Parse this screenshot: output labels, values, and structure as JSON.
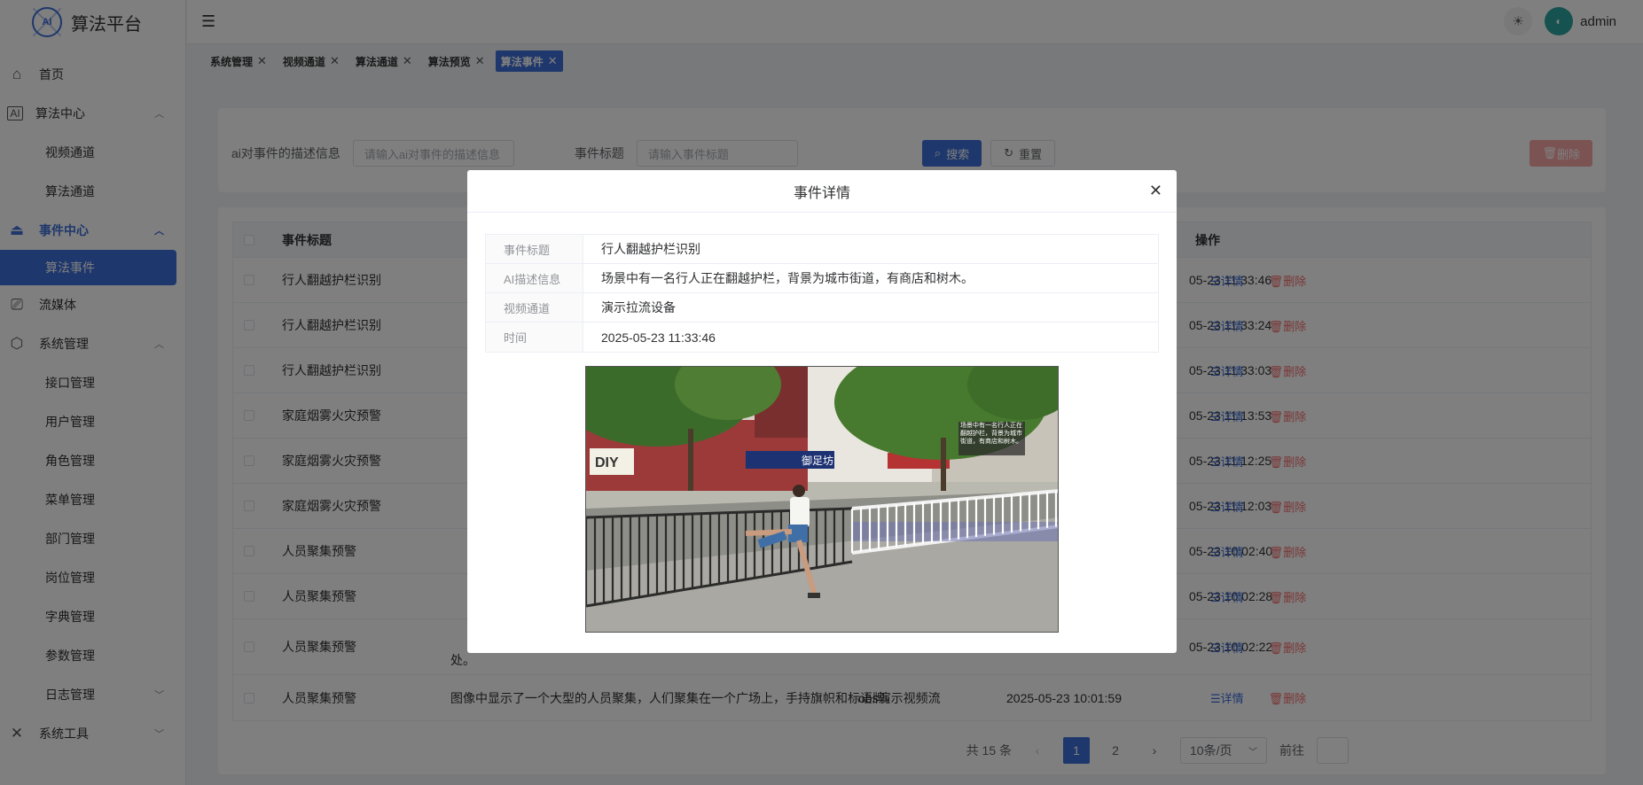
{
  "app": {
    "title": "算法平台",
    "logo_mark": "AI"
  },
  "header": {
    "menu_icon": "hamburger-icon",
    "theme_icon": "sun-icon",
    "user": "admin"
  },
  "sidebar": {
    "items": [
      {
        "label": "首页",
        "icon": "home-icon"
      },
      {
        "label": "算法中心",
        "icon": "ai-icon"
      },
      {
        "label": "视频通道"
      },
      {
        "label": "算法通道"
      },
      {
        "label": "事件中心",
        "icon": "alarm-icon"
      },
      {
        "label": "算法事件"
      },
      {
        "label": "流媒体",
        "icon": "video-icon"
      },
      {
        "label": "系统管理",
        "icon": "settings-icon"
      },
      {
        "label": "接口管理"
      },
      {
        "label": "用户管理"
      },
      {
        "label": "角色管理"
      },
      {
        "label": "菜单管理"
      },
      {
        "label": "部门管理"
      },
      {
        "label": "岗位管理"
      },
      {
        "label": "字典管理"
      },
      {
        "label": "参数管理"
      },
      {
        "label": "日志管理"
      },
      {
        "label": "系统工具",
        "icon": "tools-icon"
      }
    ]
  },
  "tabs": [
    {
      "label": "系统管理"
    },
    {
      "label": "视频通道"
    },
    {
      "label": "算法通道"
    },
    {
      "label": "算法预览"
    },
    {
      "label": "算法事件"
    }
  ],
  "search": {
    "desc_label": "ai对事件的描述信息",
    "desc_placeholder": "请输入ai对事件的描述信息",
    "title_label": "事件标题",
    "title_placeholder": "请输入事件标题",
    "search_btn": "搜索",
    "reset_btn": "重置",
    "delete_btn": "删除"
  },
  "table": {
    "headers": {
      "title": "事件标题",
      "op": "操作"
    },
    "detail_label": "详情",
    "delete_label": "删除",
    "rows": [
      {
        "title": "行人翻越护栏识别",
        "time": "05-23 11:33:46"
      },
      {
        "title": "行人翻越护栏识别",
        "time": "05-23 11:33:24"
      },
      {
        "title": "行人翻越护栏识别",
        "time": "05-23 11:33:03"
      },
      {
        "title": "家庭烟雾火灾预警",
        "time": "05-23 11:13:53"
      },
      {
        "title": "家庭烟雾火灾预警",
        "time": "05-23 11:12:25"
      },
      {
        "title": "家庭烟雾火灾预警",
        "time": "05-23 11:12:03"
      },
      {
        "title": "人员聚集预警",
        "time": "05-23 10:02:40"
      },
      {
        "title": "人员聚集预警",
        "time": "05-23 10:02:28"
      },
      {
        "title": "人员聚集预警",
        "time": "05-23 10:02:22",
        "desc": "处。"
      },
      {
        "title": "人员聚集预警",
        "desc": "图像中显示了一个大型的人员聚集，人们聚集在一个广场上，手持旗帜和标语牌。",
        "channel": "obs演示视频流",
        "time": "2025-05-23 10:01:59"
      }
    ]
  },
  "pagination": {
    "total": "共 15 条",
    "pages": [
      "1",
      "2"
    ],
    "size": "10条/页",
    "jump_label": "前往"
  },
  "modal": {
    "title": "事件详情",
    "fields": [
      {
        "label": "事件标题",
        "value": "行人翻越护栏识别"
      },
      {
        "label": "AI描述信息",
        "value": "场景中有一名行人正在翻越护栏，背景为城市街道，有商店和树木。"
      },
      {
        "label": "视频通道",
        "value": "演示拉流设备"
      },
      {
        "label": "时间",
        "value": "2025-05-23 11:33:46"
      }
    ],
    "image": {
      "overlay_text": "场景中有一名行人正在翻越护栏，背景为城市街道，有商店和树木。",
      "shop_sign_1": "DIY",
      "shop_sign_2": "御足坊"
    }
  }
}
